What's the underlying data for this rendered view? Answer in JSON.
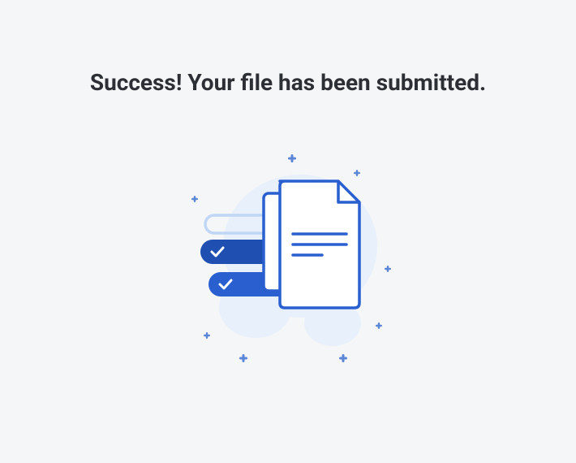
{
  "message": {
    "title": "Success! Your file has been submitted."
  },
  "colors": {
    "primary_blue": "#2a5fd0",
    "light_blue_bg": "#e8f0fc",
    "very_light_blue": "#bfd6f5",
    "dark_blue": "#1f4fb0",
    "text_dark": "#2c2f33",
    "page_bg": "#f5f6f7",
    "white": "#ffffff"
  },
  "icon": {
    "name": "documents-submitted",
    "description": "stacked paper documents with checkmark pills and sparkle decorations"
  }
}
